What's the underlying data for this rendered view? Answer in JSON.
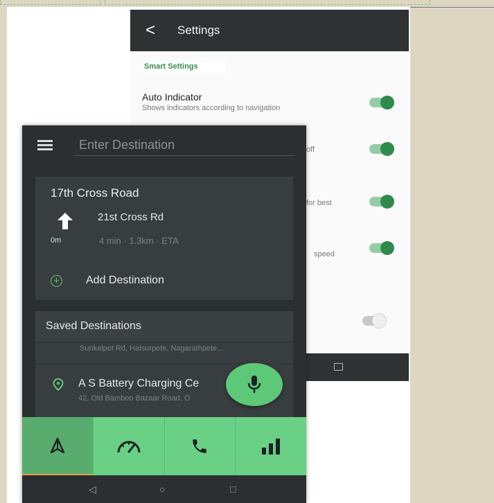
{
  "settings": {
    "title": "Settings",
    "section_label": "Smart Settings",
    "items": [
      {
        "name": "Auto Indicator",
        "desc": "Shows indicators according to navigation",
        "on": true
      },
      {
        "desc_fragment": "off",
        "on": true
      },
      {
        "desc_fragment": "for best",
        "on": true
      },
      {
        "desc_fragment": "speed",
        "on": true
      },
      {
        "on": false
      }
    ]
  },
  "nav": {
    "search_placeholder": "Enter Destination",
    "route": {
      "title": "17th Cross Road",
      "street": "21st Cross Rd",
      "distance": "0m",
      "eta": "4 min · 1.3km · ETA"
    },
    "add_destination_label": "Add Destination",
    "saved": {
      "title": "Saved Destinations",
      "first_address": "Sunkalpet Rd, Halsurpete, Nagarathpete...",
      "second_name": "A S Battery Charging Ce",
      "second_address": "42, Old Bamboo Bazaar Road, O"
    },
    "bottom_tabs": [
      "navigation-icon",
      "speedometer-icon",
      "phone-icon",
      "signal-bars-icon"
    ]
  },
  "colors": {
    "accent_green": "#5cc878",
    "dark_bg": "#2b2f31",
    "card_bg": "#383d3f",
    "toggle_on": "#2f8a4c"
  }
}
